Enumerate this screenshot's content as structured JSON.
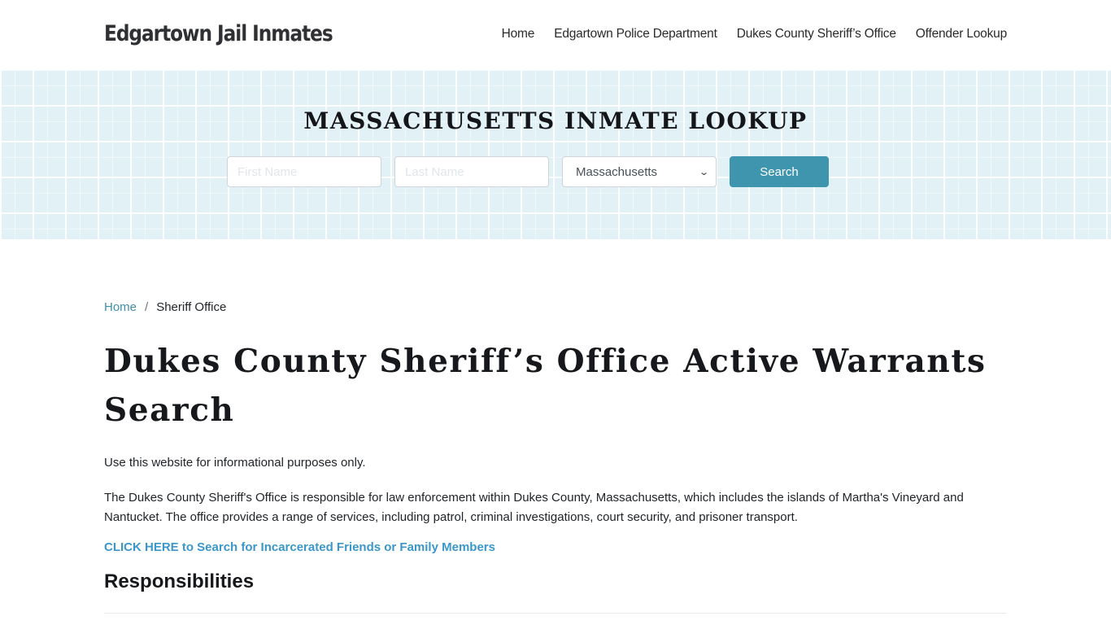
{
  "header": {
    "brand": "Edgartown Jail Inmates",
    "nav": [
      {
        "label": "Home"
      },
      {
        "label": "Edgartown Police Department"
      },
      {
        "label": "Dukes County Sheriff’s Office"
      },
      {
        "label": "Offender Lookup"
      }
    ]
  },
  "hero": {
    "title": "MASSACHUSETTS INMATE LOOKUP",
    "first_name_placeholder": "First Name",
    "first_name_value": "",
    "last_name_placeholder": "Last Name",
    "last_name_value": "",
    "state_selected": "Massachusetts",
    "search_label": "Search",
    "search_button_color": "#3f95ad",
    "background_color": "#e2f1f6"
  },
  "breadcrumb": {
    "home": "Home",
    "separator": "/",
    "current": "Sheriff Office"
  },
  "content": {
    "title": "Dukes County Sheriff’s Office Active Warrants Search",
    "disclaimer": "Use this website for informational purposes only.",
    "intro": "The Dukes County Sheriff's Office is responsible for law enforcement within Dukes County, Massachusetts, which includes the islands of Martha's Vineyard and Nantucket. The office provides a range of services, including patrol, criminal investigations, court security, and prisoner transport.",
    "cta_link": "CLICK HERE to Search for Incarcerated Friends or Family Members",
    "section_heading": "Responsibilities",
    "link_color": "#3b97c9"
  }
}
